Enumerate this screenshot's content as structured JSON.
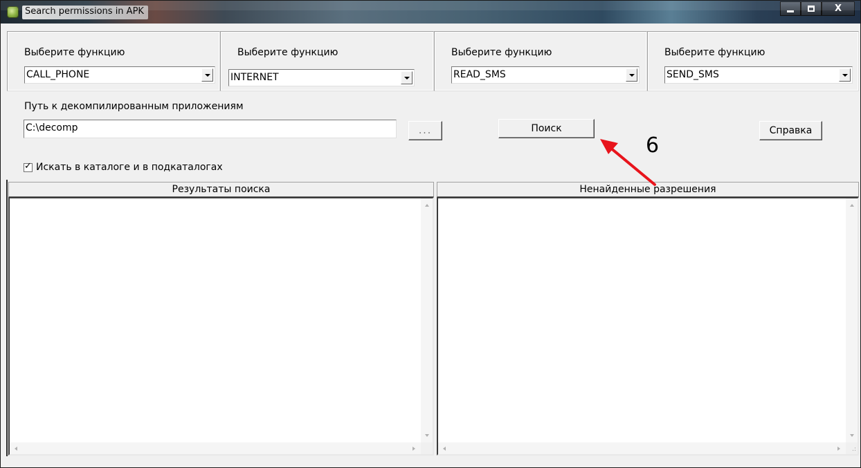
{
  "window": {
    "title": "Search permissions in APK",
    "controls": {
      "minimize": "minimize-icon",
      "maximize": "maximize-icon",
      "close_label": "X"
    }
  },
  "functions": [
    {
      "label": "Выберите функцию",
      "value": "CALL_PHONE"
    },
    {
      "label": "Выберите функцию",
      "value": "INTERNET"
    },
    {
      "label": "Выберите функцию",
      "value": "READ_SMS"
    },
    {
      "label": "Выберите функцию",
      "value": "SEND_SMS"
    }
  ],
  "path": {
    "label": "Путь к декомпилированным приложениям",
    "value": "C:\\decomp",
    "browse_label": "..."
  },
  "buttons": {
    "search_label": "Поиск",
    "help_label": "Справка"
  },
  "subdirs": {
    "label": "Искать в каталоге и в подкаталогах",
    "checked": true,
    "mark": "✓"
  },
  "panes": {
    "results_header": "Результаты поиска",
    "missing_header": "Ненайденные разрешения"
  },
  "annotation": {
    "number": "6",
    "color": "#e8141c"
  }
}
